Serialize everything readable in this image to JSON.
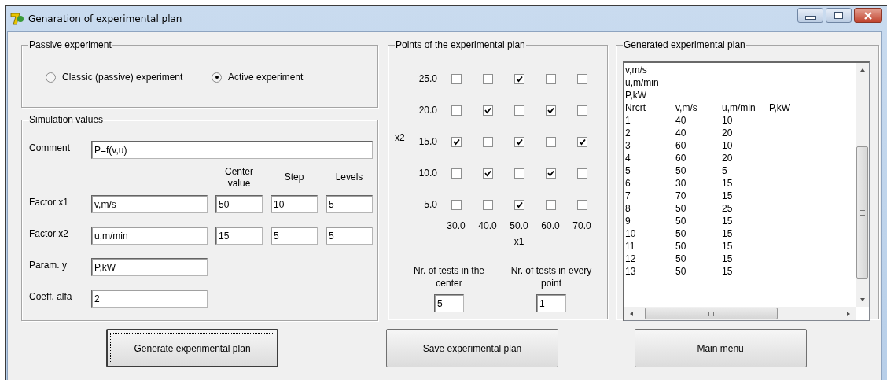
{
  "window": {
    "title": "Genaration of experimental plan"
  },
  "experiment_type": {
    "title": "Passive experiment",
    "options": [
      {
        "label": "Classic (passive) experiment",
        "selected": false
      },
      {
        "label": "Active experiment",
        "selected": true
      }
    ]
  },
  "simulation": {
    "title": "Simulation values",
    "comment": {
      "label": "Comment",
      "value": "P=f(v,u)"
    },
    "columns": [
      "Center value",
      "Step",
      "Levels"
    ],
    "factors": [
      {
        "label": "Factor x1",
        "name": "v,m/s",
        "values": [
          "50",
          "10",
          "5"
        ]
      },
      {
        "label": "Factor x2",
        "name": "u,m/min",
        "values": [
          "15",
          "5",
          "5"
        ]
      }
    ],
    "param": {
      "label": "Param. y",
      "value": "P,kW"
    },
    "alfa": {
      "label": "Coeff. alfa",
      "value": "2"
    }
  },
  "points": {
    "title": "Points of the experimental plan",
    "y_axis": "x2",
    "x_axis": "x1",
    "rows": [
      {
        "label": "25.0",
        "cells": [
          {
            "checked": false
          },
          {
            "checked": false
          },
          {
            "checked": true
          },
          {
            "checked": false
          },
          {
            "checked": false
          }
        ]
      },
      {
        "label": "20.0",
        "cells": [
          {
            "checked": false
          },
          {
            "checked": true
          },
          {
            "checked": false
          },
          {
            "checked": true
          },
          {
            "checked": false
          }
        ]
      },
      {
        "label": "15.0",
        "cells": [
          {
            "checked": true
          },
          {
            "checked": false
          },
          {
            "checked": true
          },
          {
            "checked": false
          },
          {
            "checked": true
          }
        ]
      },
      {
        "label": "10.0",
        "cells": [
          {
            "checked": false
          },
          {
            "checked": true
          },
          {
            "checked": false
          },
          {
            "checked": true
          },
          {
            "checked": false
          }
        ]
      },
      {
        "label": "5.0",
        "cells": [
          {
            "checked": false
          },
          {
            "checked": false
          },
          {
            "checked": true
          },
          {
            "checked": false
          },
          {
            "checked": false
          }
        ]
      }
    ],
    "columns": [
      "30.0",
      "40.0",
      "50.0",
      "60.0",
      "70.0"
    ],
    "center_tests": {
      "label": "Nr. of tests in the center",
      "value": "5"
    },
    "point_tests": {
      "label": "Nr. of tests in every point",
      "value": "1"
    }
  },
  "plan": {
    "title": "Generated experimental plan",
    "lines": [
      "v,m/s",
      "u,m/min",
      "P,kW"
    ],
    "columns": [
      "Nrcrt",
      "v,m/s",
      "u,m/min",
      "P,kW"
    ],
    "rows": [
      [
        "1",
        "40",
        "10"
      ],
      [
        "2",
        "40",
        "20"
      ],
      [
        "3",
        "60",
        "10"
      ],
      [
        "4",
        "60",
        "20"
      ],
      [
        "5",
        "50",
        "5"
      ],
      [
        "6",
        "30",
        "15"
      ],
      [
        "7",
        "70",
        "15"
      ],
      [
        "8",
        "50",
        "25"
      ],
      [
        "9",
        "50",
        "15"
      ],
      [
        "10",
        "50",
        "15"
      ],
      [
        "11",
        "50",
        "15"
      ],
      [
        "12",
        "50",
        "15"
      ],
      [
        "13",
        "50",
        "15"
      ]
    ]
  },
  "buttons": [
    {
      "label": "Generate experimental plan",
      "focused": true
    },
    {
      "label": "Save experimental plan",
      "focused": false
    },
    {
      "label": "Main menu",
      "focused": false
    }
  ]
}
